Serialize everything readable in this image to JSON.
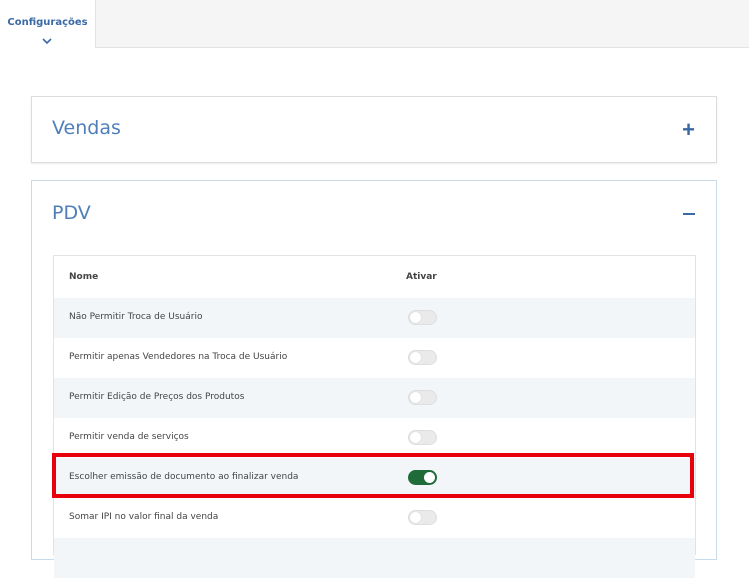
{
  "tabs": {
    "active_label": "Configurações"
  },
  "panels": {
    "vendas": {
      "title": "Vendas",
      "toggle": "+"
    },
    "pdv": {
      "title": "PDV",
      "toggle": "−"
    }
  },
  "table": {
    "headers": {
      "nome": "Nome",
      "ativar": "Ativar"
    },
    "rows": [
      {
        "label": "Não Permitir Troca de Usuário",
        "enabled": false
      },
      {
        "label": "Permitir apenas Vendedores na Troca de Usuário",
        "enabled": false
      },
      {
        "label": "Permitir Edição de Preços dos Produtos",
        "enabled": false
      },
      {
        "label": "Permitir venda de serviços",
        "enabled": false
      },
      {
        "label": "Escolher emissão de documento ao finalizar venda",
        "enabled": true
      },
      {
        "label": "Somar IPI no valor final da venda",
        "enabled": false
      }
    ]
  },
  "colors": {
    "accent": "#3a6aa6",
    "switch_on": "#1f6b3a",
    "highlight": "#e8000a"
  }
}
